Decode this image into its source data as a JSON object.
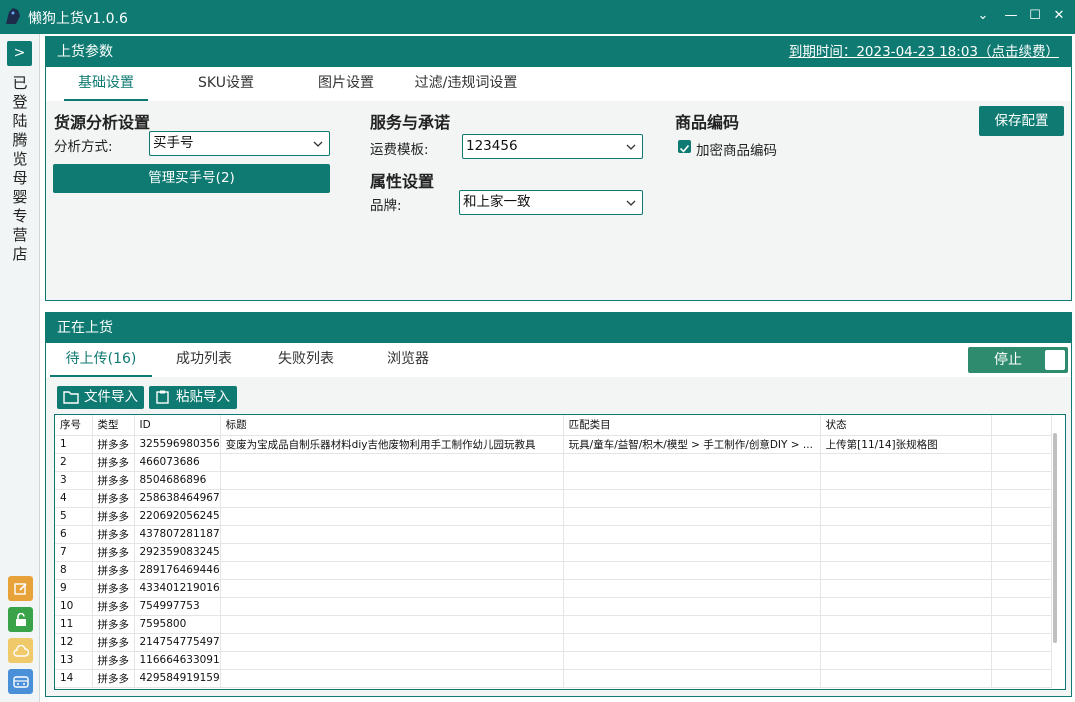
{
  "app": {
    "title": "懒狗上货v1.0.6"
  },
  "sidebar": {
    "expand_label": ">",
    "status_text": "已登陆 腾览母婴专营店"
  },
  "upload_params": {
    "header": "上货参数",
    "expiry_link": "到期时间：2023-04-23 18:03（点击续费）",
    "tabs": [
      "基础设置",
      "SKU设置",
      "图片设置",
      "过滤/违规词设置"
    ],
    "source": {
      "title": "货源分析设置",
      "method_label": "分析方式:",
      "method_value": "买手号",
      "manage_button": "管理买手号(2)"
    },
    "service": {
      "title": "服务与承诺",
      "freight_label": "运费模板:",
      "freight_value": "123456"
    },
    "attr": {
      "title": "属性设置",
      "brand_label": "品牌:",
      "brand_value": "和上家一致"
    },
    "code": {
      "title": "商品编码",
      "encrypt_label": "加密商品编码",
      "encrypt_checked": true
    },
    "save_button": "保存配置"
  },
  "uploading": {
    "header": "正在上货",
    "tabs": [
      "待上传(16)",
      "成功列表",
      "失败列表",
      "浏览器"
    ],
    "stop_label": "停止",
    "file_import": "文件导入",
    "paste_import": "粘贴导入",
    "columns": [
      "序号",
      "类型",
      "ID",
      "标题",
      "匹配类目",
      "状态"
    ],
    "rows": [
      {
        "no": "1",
        "type": "拼多多",
        "id": "325596980356",
        "title": "变废为宝成品自制乐器材料diy吉他废物利用手工制作幼儿园玩教具",
        "cat": "玩具/童车/益智/积木/模型 > 手工制作/创意DIY > ...",
        "status": "上传第[11/14]张规格图"
      },
      {
        "no": "2",
        "type": "拼多多",
        "id": "466073686",
        "title": "",
        "cat": "",
        "status": ""
      },
      {
        "no": "3",
        "type": "拼多多",
        "id": "8504686896",
        "title": "",
        "cat": "",
        "status": ""
      },
      {
        "no": "4",
        "type": "拼多多",
        "id": "258638464967",
        "title": "",
        "cat": "",
        "status": ""
      },
      {
        "no": "5",
        "type": "拼多多",
        "id": "220692056245",
        "title": "",
        "cat": "",
        "status": ""
      },
      {
        "no": "6",
        "type": "拼多多",
        "id": "437807281187",
        "title": "",
        "cat": "",
        "status": ""
      },
      {
        "no": "7",
        "type": "拼多多",
        "id": "292359083245",
        "title": "",
        "cat": "",
        "status": ""
      },
      {
        "no": "8",
        "type": "拼多多",
        "id": "289176469446",
        "title": "",
        "cat": "",
        "status": ""
      },
      {
        "no": "9",
        "type": "拼多多",
        "id": "433401219016",
        "title": "",
        "cat": "",
        "status": ""
      },
      {
        "no": "10",
        "type": "拼多多",
        "id": "754997753",
        "title": "",
        "cat": "",
        "status": ""
      },
      {
        "no": "11",
        "type": "拼多多",
        "id": "7595800",
        "title": "",
        "cat": "",
        "status": ""
      },
      {
        "no": "12",
        "type": "拼多多",
        "id": "214754775497",
        "title": "",
        "cat": "",
        "status": ""
      },
      {
        "no": "13",
        "type": "拼多多",
        "id": "116664633091",
        "title": "",
        "cat": "",
        "status": ""
      },
      {
        "no": "14",
        "type": "拼多多",
        "id": "429584919159",
        "title": "",
        "cat": "",
        "status": ""
      }
    ]
  },
  "colors": {
    "accent": "#0e7a72",
    "toggle": "#2e8b6e",
    "edit_icon": "#e8a23a",
    "lock_icon": "#3aa34a",
    "cloud_icon": "#f0c96a",
    "store_icon": "#4a90d9"
  }
}
